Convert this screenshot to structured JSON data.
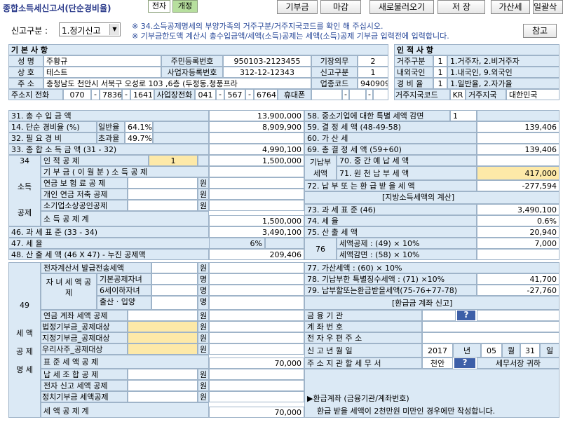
{
  "title": "종합소득세신고서(단순경비율)",
  "tabs": [
    "전자",
    "개정"
  ],
  "toolbar": [
    "기부금",
    "마감",
    "새로불러오기",
    "저 장",
    "가산세",
    "일괄삭"
  ],
  "report_type_label": "신고구분 :",
  "report_type_value": "1.정기신고",
  "notes": [
    "※ 34.소득공제명세의 부양가족의 거주구분/거주지국코드를 확인 해 주십시오.",
    "※ 기부금한도액 계산시 총수입금액/세액(소득)공제는 세액(소득)공제 기부금 입력전에 입력합니다."
  ],
  "help": "참고",
  "basic": {
    "header": "기 본 사 항",
    "name_l": "성 명",
    "name": "주황규",
    "rrn_l": "주민등록번호",
    "rrn": "950103-2123455",
    "duty_l": "기장의무",
    "duty": "2",
    "biz_l": "상 호",
    "biz": "테스트",
    "brn_l": "사업자등록번호",
    "brn": "312-12-12343",
    "rtype_l": "신고구분",
    "rtype": "1",
    "addr_l": "주 소",
    "addr": "충청남도 천안시 서북구 오성로 103 ,6층 (두정동,청풍프라",
    "code_l": "업종코드",
    "code": "940909",
    "tel_l": "주소지 전화",
    "tel1": "070",
    "tel2": "7836",
    "tel3": "1641",
    "wtel_l": "사업장전화",
    "wtel1": "041",
    "wtel2": "567",
    "wtel3": "6764",
    "mob_l": "휴대폰"
  },
  "person": {
    "header": "인 적 사 항",
    "r1l": "거주구분",
    "r1v": "1",
    "r1d": "1.거주자, 2.비거주자",
    "r2l": "내외국인",
    "r2v": "1",
    "r2d": "1.내국인, 9.외국인",
    "r3l": "경 비 율",
    "r3v": "1",
    "r3d": "1.일반율, 2.자가율",
    "r4l": "거주지국코드",
    "r4v": "KR",
    "r4m": "거주지국",
    "r4d": "대한민국"
  },
  "left": {
    "l31": "31. 총 수 입 금 액",
    "v31": "13,900,000",
    "l14": "14. 단순 경비율 (%)",
    "l14a": "일반율",
    "v14a": "64.1%",
    "v14": "8,909,900",
    "l32": "32. 필 요 경 비",
    "l14b": "초과율",
    "v14b": "49.7%",
    "l33": "33. 종 합 소 득 금 액 (31 - 32)",
    "v33": "4,990,100",
    "l34": "34",
    "l34t": "소득",
    "l34b": "공제",
    "pd_l": "인 적 공 제",
    "pd_n": "1",
    "pd_v": "1,500,000",
    "don_l": "기 부 금 ( 이 월 분 ) 소 득 공 제",
    "pen_l": "연금 보 험 료 공 제",
    "pen_u": "원",
    "ipen_l": "개인 연금 저축 공제",
    "ipen_u": "원",
    "sm_l": "소기업소상공인공제",
    "sm_u": "원",
    "tot_l": "소 득 공 제 계",
    "tot_v": "1,500,000",
    "l46": "46. 과 세 표 준 (33 - 34)",
    "v46": "3,490,100",
    "l47": "47. 세 율",
    "v47": "6%",
    "l48": "48. 산 출 세 액 (46 X 47) - 누진 공제액",
    "v48": "209,406"
  },
  "right": {
    "l58": "58. 중소기업에 대한 특별 세액 감면",
    "v58": "1",
    "l59": "59. 결 정 세 액 (48-49-58)",
    "v59": "139,406",
    "l60": "60. 가 산 세",
    "l69": "69. 총 결 정 세 액 (59+60)",
    "v69": "139,406",
    "pre_l": "기납부 세액",
    "l70": "70. 중 간 예 납 세 액",
    "l71": "71. 원 천 납 부 세 액",
    "v71": "417,000",
    "l72": "72. 납 부 또 는 환 급 받 을 세 액",
    "v72": "-277,594",
    "local_h": "[지방소득세액의 계산]",
    "l73": "73. 과 세 표 준 (46)",
    "v73": "3,490,100",
    "l74": "74. 세 율",
    "v74": "0.6%",
    "l75": "75. 산 출 세 액",
    "v75": "20,940",
    "l76": "76",
    "l76a": "세액공제 : (49) × 10%",
    "v76a": "7,000",
    "l76b": "세액감면 : (58) × 10%",
    "l77": "77. 가산세액 : (60) × 10%",
    "l78": "78. 기납부한 특별징수세액 : (71) ×10%",
    "v78": "41,700",
    "l79": "79. 납부할또는환급받을세액(75-76+77-78)",
    "v79": "-27,760",
    "ref_h": "[환급금 계좌 신고]",
    "bank_l": "금 융 기 관",
    "acct_l": "계 좌 번 호",
    "post_l": "전 자 우 편 주 소",
    "date_l": "신 고 년 월 일",
    "year": "2017",
    "yu": "년",
    "month": "05",
    "mu": "월",
    "day": "31",
    "du": "일",
    "tax_l": "주 소 지 관 할 세 무 서",
    "tax_v": "천안",
    "tax_s": "세무서장 귀하",
    "foot1": "▶환급계좌 (금융기관/계좌번호)",
    "foot2": "환급 받을 세액이 2천만원 미만인 경우에만 작성합니다."
  },
  "credits": {
    "l49": "49",
    "side": [
      "세 액",
      "공 제",
      "명 세"
    ],
    "e_l": "전자계산서 발급전송세액",
    "e_u": "원",
    "ch_l": "자 녀 세 액 공 제",
    "ch1": "기본공제자녀",
    "ch1u": "명",
    "ch2": "6세이하자녀",
    "ch2u": "명",
    "ch3": "출산 · 입양",
    "ch3u": "명",
    "pen2": "연금 계좌 세액 공제",
    "pen2u": "원",
    "ld": "법정기부금_공제대상",
    "ldu": "원",
    "dd": "지정기부금_공제대상",
    "ddu": "원",
    "ws": "우리사주_공제대상",
    "wsu": "원",
    "std": "표 준 세 액 공 제",
    "std_v": "70,000",
    "tax_u": "납 세 조 합 공 제",
    "tax_uu": "원",
    "ef": "전자 신고 세액 공제",
    "efu": "원",
    "pol": "정치기부금 세액공제",
    "polu": "원",
    "sum": "세 액 공 제 계",
    "sum_v": "70,000"
  },
  "q": "?",
  "colors": {
    "label_bg": "#dbe9f5",
    "highlight": "#fde9a8",
    "qbtn": "#3d5fa8"
  }
}
